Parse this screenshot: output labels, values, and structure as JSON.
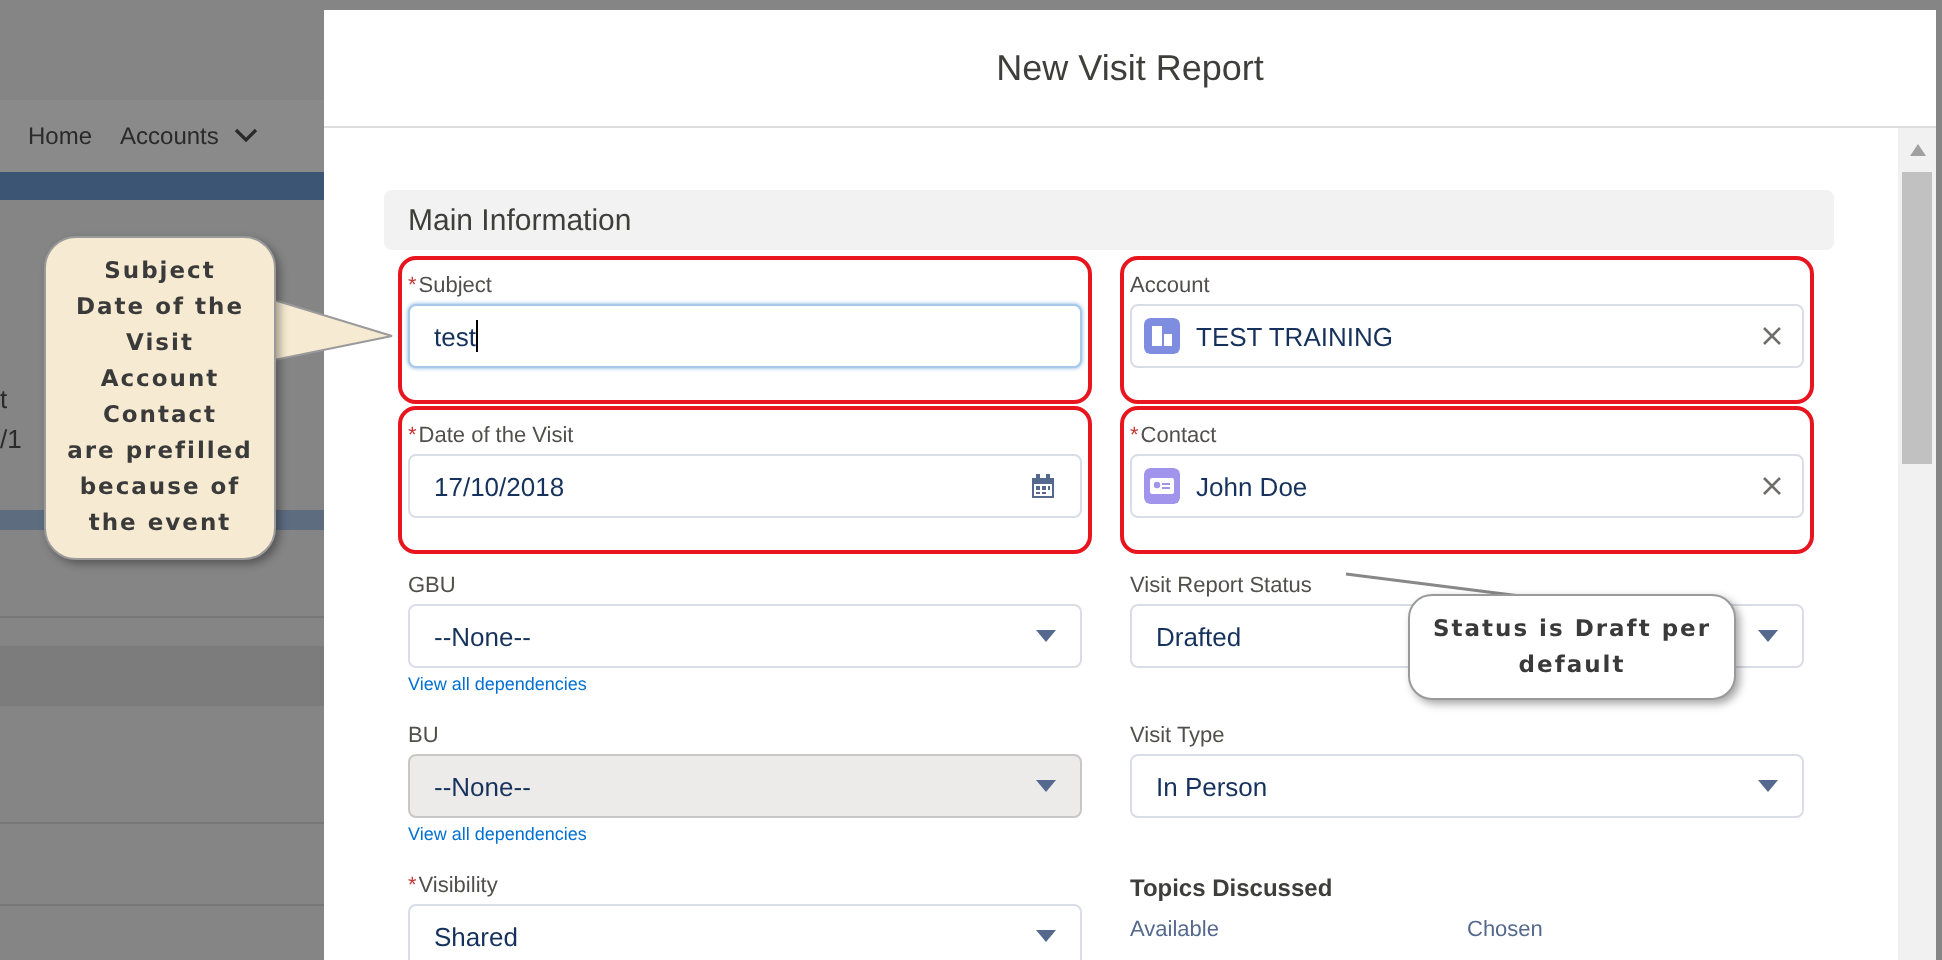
{
  "background": {
    "nav": [
      {
        "label": "Home",
        "caret": false
      },
      {
        "label": "Accounts",
        "caret": true
      }
    ],
    "fragments": [
      "t",
      "/1"
    ]
  },
  "modal": {
    "title": "New Visit Report"
  },
  "section": {
    "title": "Main Information"
  },
  "left_fields": [
    {
      "kind": "text",
      "label": "Subject",
      "required_mark": "*",
      "value": "test",
      "highlighted": true,
      "focused": true
    },
    {
      "kind": "date",
      "label": "Date of the Visit",
      "required_mark": "*",
      "value": "17/10/2018",
      "highlighted": true
    },
    {
      "kind": "picklist",
      "label": "GBU",
      "value": "--None--",
      "disabled": false,
      "link": "View all dependencies"
    },
    {
      "kind": "picklist",
      "label": "BU",
      "value": "--None--",
      "disabled": true,
      "link": "View all dependencies"
    },
    {
      "kind": "picklist",
      "label": "Visibility",
      "required_mark": "*",
      "value": "Shared",
      "disabled": false
    }
  ],
  "right_fields": [
    {
      "kind": "account_lookup",
      "label": "Account",
      "value": "TEST TRAINING",
      "highlighted": true
    },
    {
      "kind": "contact_lookup",
      "label": "Contact",
      "required_mark": "*",
      "value": "John Doe",
      "highlighted": true
    },
    {
      "kind": "picklist",
      "label": "Visit Report Status",
      "value": "Drafted",
      "disabled": false
    },
    {
      "kind": "picklist",
      "label": "Visit Type",
      "value": "In Person",
      "disabled": false
    },
    {
      "kind": "dual_list",
      "label": "Topics Discussed",
      "columns": [
        "Available",
        "Chosen"
      ]
    }
  ],
  "callouts": [
    {
      "kind": "pointer",
      "lines": [
        "Subject",
        "Date of the",
        "Visit",
        "Account",
        "Contact",
        "are prefilled",
        "because of",
        "the event"
      ]
    },
    {
      "kind": "leader",
      "lines": [
        "Status is Draft per",
        "default"
      ]
    }
  ]
}
